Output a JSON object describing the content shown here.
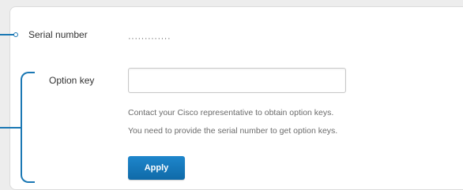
{
  "serial": {
    "label": "Serial number",
    "value": "·············"
  },
  "option_key": {
    "label": "Option key",
    "value": "",
    "placeholder": ""
  },
  "help": {
    "line1": "Contact your Cisco representative to obtain option keys.",
    "line2": "You need to provide the serial number to get option keys."
  },
  "actions": {
    "apply_label": "Apply"
  },
  "colors": {
    "accent": "#1b78b4",
    "button": "#1477bd"
  }
}
